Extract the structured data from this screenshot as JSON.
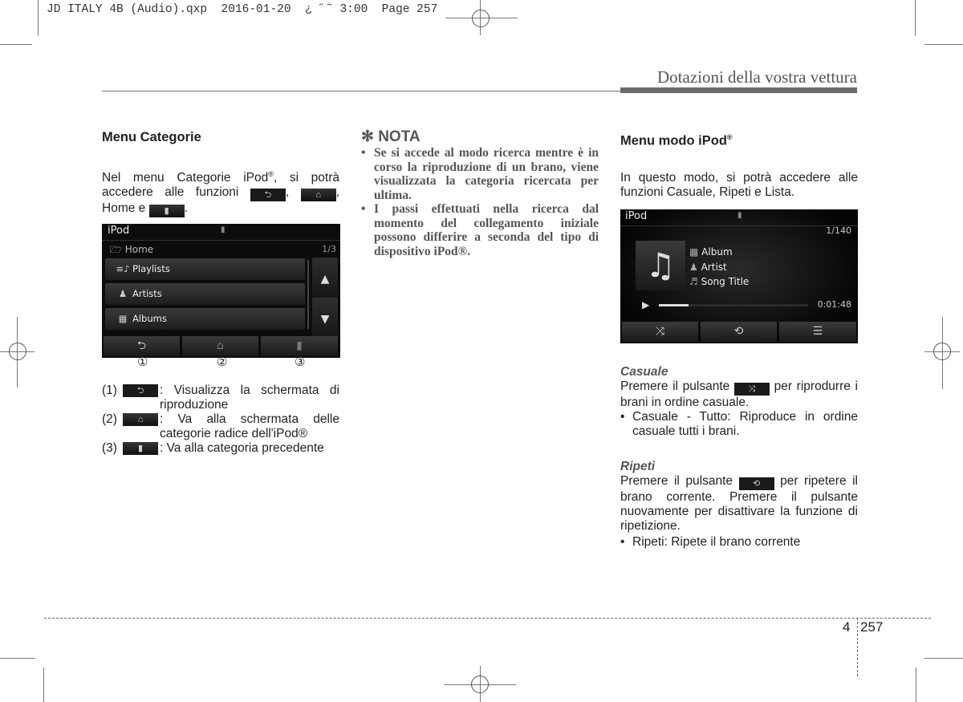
{
  "print_slug": "JD ITALY 4B (Audio).qxp  2016-01-20  ¿ ˝˜ 3:00  Page 257",
  "running_head": "Dotazioni della vostra vettura",
  "left": {
    "title": "Menu Categorie",
    "intro_1": "Nel menu Categorie iPod",
    "intro_reg": "®",
    "intro_2": ", si potrà accedere alle funzioni",
    "intro_sep": ",",
    "intro_3": ", Home e",
    "intro_end": ".",
    "screen": {
      "title": "iPod",
      "usb_icon": "usb-icon",
      "folder_label": "Home",
      "page_indicator": "1/3",
      "items": [
        {
          "icon": "playlist-icon",
          "glyph": "≡♪",
          "label": "Playlists"
        },
        {
          "icon": "artist-icon",
          "glyph": "👤",
          "label": "Artists"
        },
        {
          "icon": "album-icon",
          "glyph": "▦",
          "label": "Albums"
        }
      ],
      "scroll_up": "▲",
      "scroll_down": "▼",
      "bottom_buttons": [
        {
          "icon": "back-icon",
          "glyph": "⮌"
        },
        {
          "icon": "home-icon",
          "glyph": "⌂"
        },
        {
          "icon": "folder-up-icon",
          "glyph": "▮"
        }
      ],
      "callouts": [
        "①",
        "②",
        "③"
      ]
    },
    "legend": [
      {
        "num": "(1)",
        "glyph": "⮌",
        "text": ": Visualizza la schermata di riproduzione"
      },
      {
        "num": "(2)",
        "glyph": "⌂",
        "text": ": Va alla schermata delle categorie radice dell'iPod®"
      },
      {
        "num": "(3)",
        "glyph": "▮",
        "text": ": Va alla categoria precedente"
      }
    ]
  },
  "middle": {
    "nota_title": "✻ NOTA",
    "bullets": [
      "Se si accede al modo ricerca mentre è in corso la riproduzione di un brano, viene visualizzata la categoria ricercata per ultima.",
      "I passi effettuati nella ricerca dal momento del collegamento iniziale possono differire a seconda del tipo di dispositivo iPod®."
    ]
  },
  "right": {
    "title": "Menu modo iPod",
    "title_reg": "®",
    "intro": "In questo modo, si potrà accedere alle funzioni Casuale, Ripeti e Lista.",
    "screen": {
      "title": "iPod",
      "track_counter": "1/140",
      "album": "Album",
      "artist": "Artist",
      "song": "Song Title",
      "elapsed": "0:01:48",
      "progress": 0.2,
      "buttons": [
        {
          "icon": "shuffle-icon",
          "glyph": "⤨"
        },
        {
          "icon": "repeat-icon",
          "glyph": "⟲"
        },
        {
          "icon": "list-icon",
          "glyph": "☰"
        }
      ]
    },
    "casuale": {
      "heading": "Casuale",
      "text_before": "Premere il pulsante",
      "glyph": "⤨",
      "text_after": "per riprodurre i brani in ordine casuale.",
      "bullet": "Casuale - Tutto: Riproduce in ordine casuale tutti i brani."
    },
    "ripeti": {
      "heading": "Ripeti",
      "text_before": "Premere il pulsante",
      "glyph": "⟲",
      "text_after": "per ripetere il brano corrente. Premere il pulsante nuovamente per disattivare la funzione di ripetizione.",
      "bullet": "Ripeti: Ripete il brano corrente"
    }
  },
  "footer": {
    "chapter": "4",
    "page": "257"
  }
}
